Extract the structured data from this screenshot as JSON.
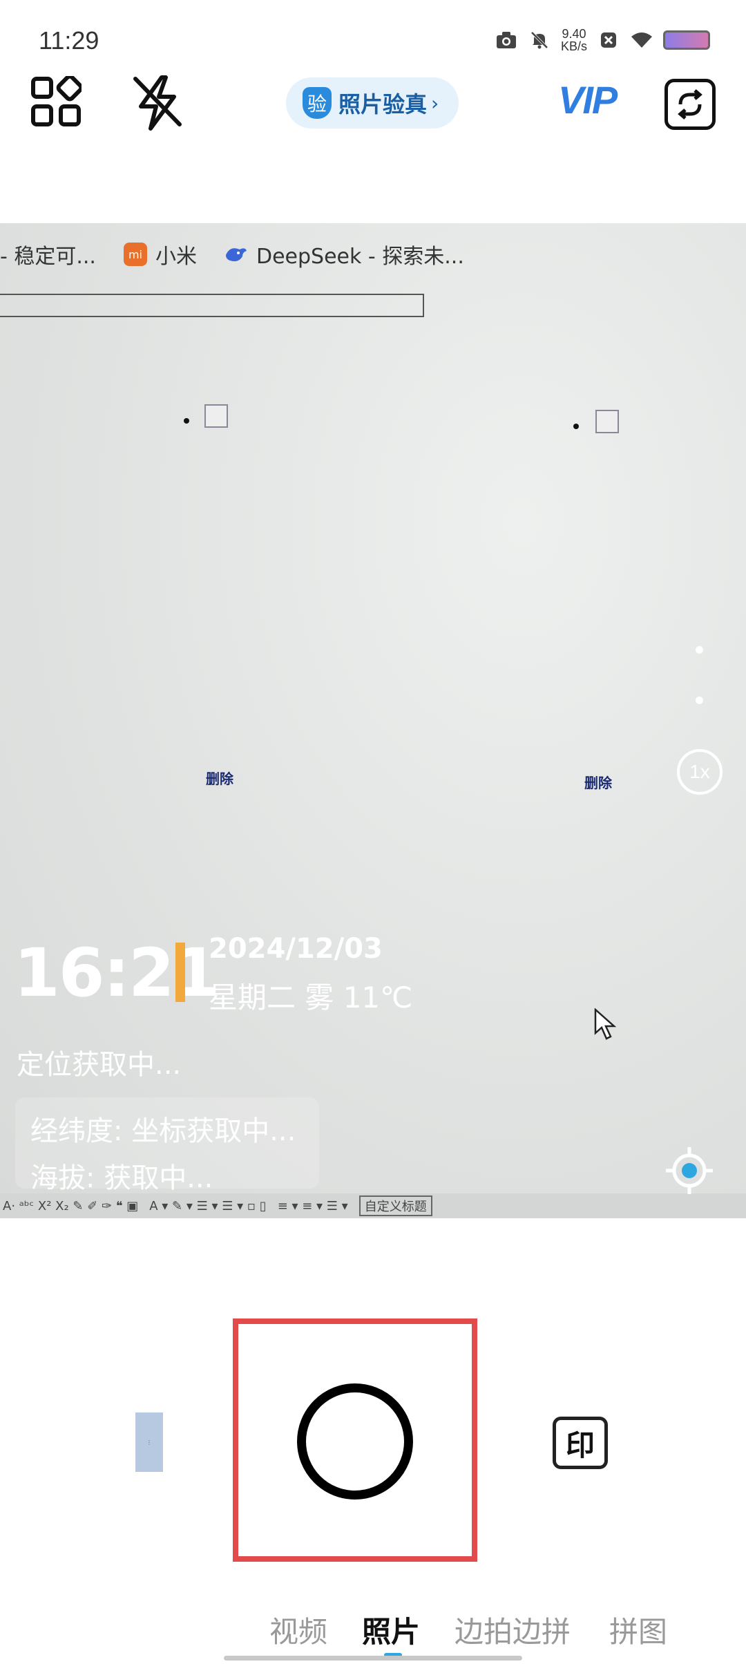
{
  "status_bar": {
    "time": "11:29",
    "net_speed_value": "9.40",
    "net_speed_unit": "KB/s",
    "icons": [
      "camera-icon",
      "mute-icon",
      "close-box-icon",
      "wifi-icon",
      "battery-icon"
    ]
  },
  "toolbar": {
    "verify_badge": "验",
    "verify_label": "照片验真",
    "verify_arrow": "›",
    "vip_label": "VIP"
  },
  "viewfinder": {
    "browser_tabs": [
      {
        "label": "- 稳定可...",
        "icon": ""
      },
      {
        "label": "小米",
        "icon": "mi"
      },
      {
        "label": "DeepSeek - 探索未...",
        "icon": ""
      }
    ],
    "delete_left": "删除",
    "delete_right": "删除",
    "zoom_label": "1x",
    "editor_custom_title": "自定义标题"
  },
  "watermark": {
    "time": "16:21",
    "date": "2024/12/03",
    "weekday_weather": "星期二 雾 11℃",
    "location": "定位获取中...",
    "coordinates": "经纬度: 坐标获取中...",
    "altitude": "海拔: 获取中..."
  },
  "controls": {
    "stamp_label": "印"
  },
  "modes": [
    {
      "label": "视频",
      "active": false
    },
    {
      "label": "照片",
      "active": true
    },
    {
      "label": "边拍边拼",
      "active": false
    },
    {
      "label": "拼图",
      "active": false
    }
  ],
  "colors": {
    "accent": "#2ea7e0",
    "vip": "#2f7ee0",
    "highlight_frame": "#e34a4a",
    "watermark_bar": "#f2a93b"
  }
}
